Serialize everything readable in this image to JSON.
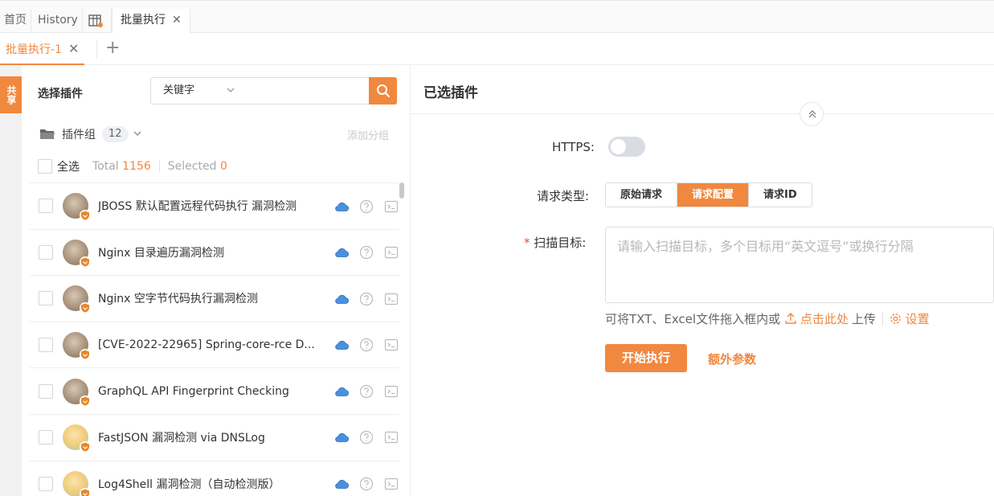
{
  "top_tabs": [
    {
      "label": "首页"
    },
    {
      "label": "History"
    },
    {
      "label": "",
      "icon": "table-icon"
    },
    {
      "label": "批量执行",
      "active": true,
      "close": "✕"
    }
  ],
  "sub_tabs": {
    "active_label": "批量执行-1",
    "close": "✕",
    "add": "+"
  },
  "side_strip": {
    "label": "共享"
  },
  "left_panel": {
    "title": "选择插件",
    "search": {
      "select_value": "关键字",
      "placeholder": ""
    },
    "group": {
      "label": "插件组",
      "count": "12",
      "add_label": "添加分组"
    },
    "selection": {
      "all_label": "全选",
      "total_label": "Total",
      "total_value": "1156",
      "selected_label": "Selected",
      "selected_value": "0"
    },
    "plugins": [
      {
        "name": "JBOSS 默认配置远程代码执行 漏洞检测",
        "avatar": "a"
      },
      {
        "name": "Nginx 目录遍历漏洞检测",
        "avatar": "a"
      },
      {
        "name": "Nginx 空字节代码执行漏洞检测",
        "avatar": "a"
      },
      {
        "name": "[CVE-2022-22965] Spring-core-rce D...",
        "avatar": "a"
      },
      {
        "name": "GraphQL API Fingerprint Checking",
        "avatar": "a"
      },
      {
        "name": "FastJSON 漏洞检测 via DNSLog",
        "avatar": "b"
      },
      {
        "name": "Log4Shell 漏洞检测（自动检测版）",
        "avatar": "b"
      }
    ]
  },
  "right_panel": {
    "title": "已选插件",
    "https_label": "HTTPS:",
    "https_enabled": false,
    "request_type_label": "请求类型:",
    "request_types": [
      "原始请求",
      "请求配置",
      "请求ID"
    ],
    "request_type_selected": "请求配置",
    "target_label": "扫描目标:",
    "target_required": "*",
    "target_placeholder": "请输入扫描目标，多个目标用“英文逗号”或换行分隔",
    "hint_text": "可将TXT、Excel文件拖入框内或",
    "upload_link": "点击此处",
    "upload_suffix": "上传",
    "settings_link": "设置",
    "run_button": "开始执行",
    "extra_params": "额外参数"
  },
  "colors": {
    "accent": "#f0883f",
    "required": "#e54b4b",
    "cloud": "#4a90e2"
  }
}
